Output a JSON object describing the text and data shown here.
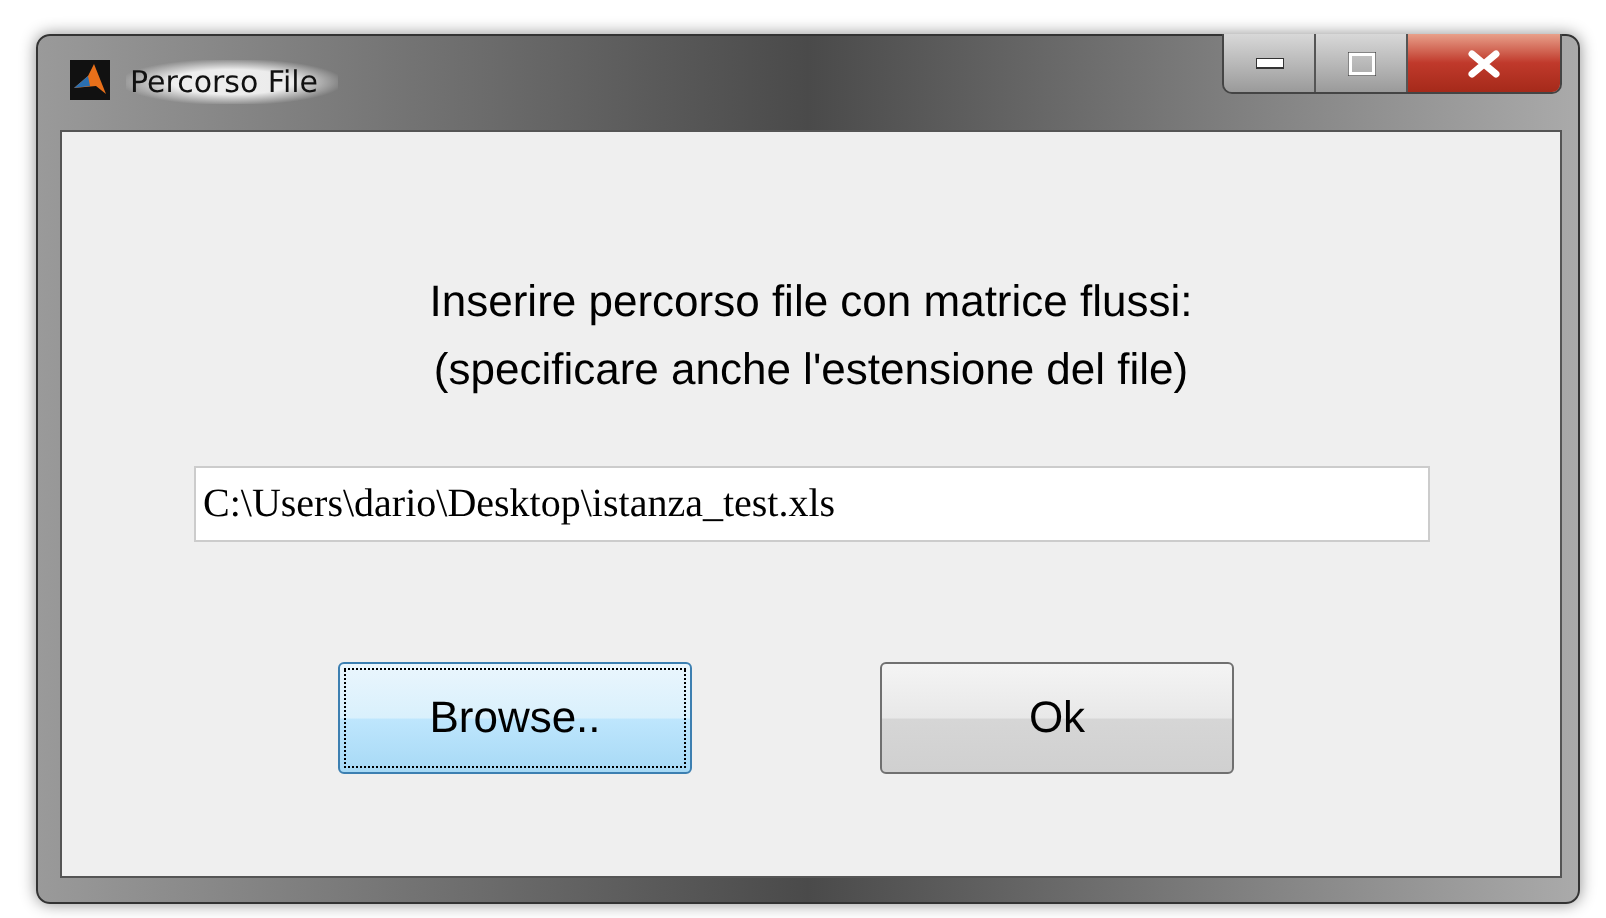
{
  "window": {
    "title": "Percorso File"
  },
  "prompt": [
    "Inserire percorso file con matrice flussi:",
    "(specificare anche l'estensione del file)"
  ],
  "path_field": {
    "value": "C:\\Users\\dario\\Desktop\\istanza_test.xls"
  },
  "buttons": [
    {
      "label": "Browse..",
      "focused": true
    },
    {
      "label": "Ok",
      "focused": false
    }
  ]
}
